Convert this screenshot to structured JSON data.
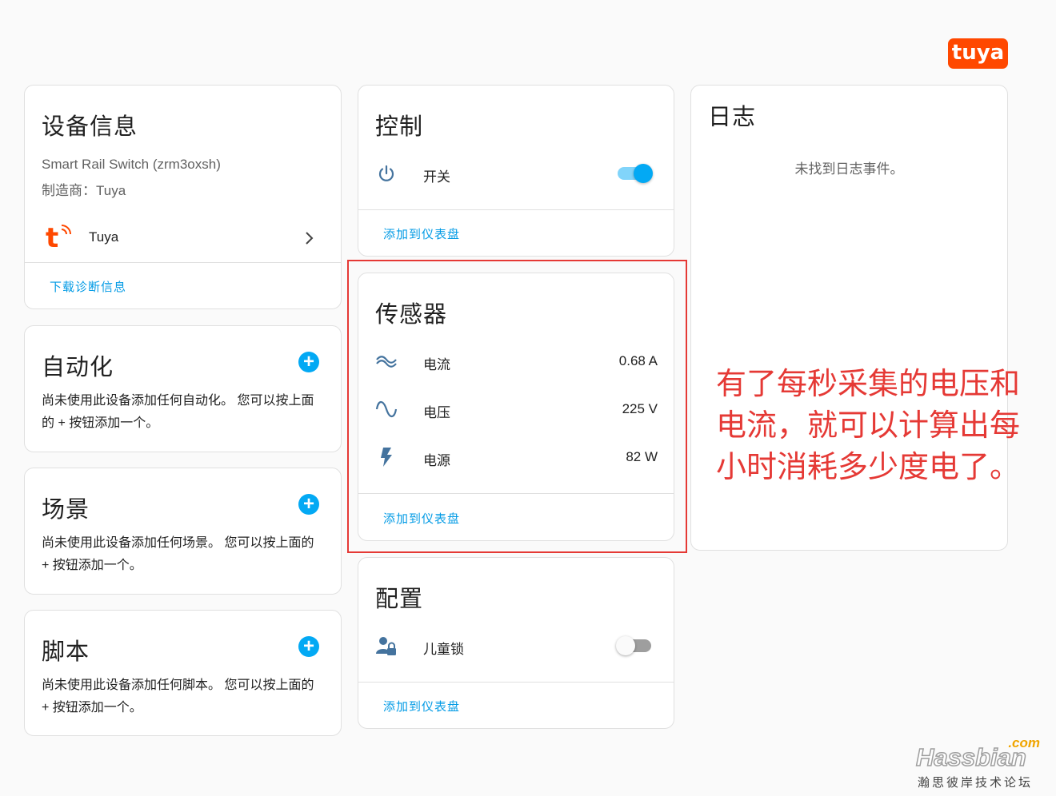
{
  "brand": {
    "logo_text": "tuya",
    "color": "#ff4800"
  },
  "device_info": {
    "title": "设备信息",
    "model": "Smart Rail Switch (zrm3oxsh)",
    "manufacturer": "制造商：Tuya",
    "integration": "Tuya",
    "download_diagnostics": "下载诊断信息"
  },
  "automation": {
    "title": "自动化",
    "description": "尚未使用此设备添加任何自动化。 您可以按上面的 + 按钮添加一个。"
  },
  "scene": {
    "title": "场景",
    "description": "尚未使用此设备添加任何场景。 您可以按上面的 + 按钮添加一个。"
  },
  "script": {
    "title": "脚本",
    "description": "尚未使用此设备添加任何脚本。 您可以按上面的 + 按钮添加一个。"
  },
  "control": {
    "title": "控制",
    "switch_label": "开关",
    "switch_on": true,
    "add_to_dashboard": "添加到仪表盘"
  },
  "sensors": {
    "title": "传感器",
    "items": [
      {
        "icon": "current-ac-icon",
        "label": "电流",
        "value": "0.68 A"
      },
      {
        "icon": "sine-wave-icon",
        "label": "电压",
        "value": "225 V"
      },
      {
        "icon": "lightning-bolt-icon",
        "label": "电源",
        "value": "82 W"
      }
    ],
    "add_to_dashboard": "添加到仪表盘"
  },
  "config": {
    "title": "配置",
    "child_lock_label": "儿童锁",
    "child_lock_on": false,
    "add_to_dashboard": "添加到仪表盘"
  },
  "logbook": {
    "title": "日志",
    "empty": "未找到日志事件。"
  },
  "annotation": {
    "text": "有了每秒采集的电压和电流，就可以计算出每小时消耗多少度电了。",
    "color": "#e53935"
  },
  "watermark": {
    "com": ".com",
    "name": "Hassbian",
    "subtitle": "瀚思彼岸技术论坛"
  },
  "colors": {
    "accent": "#03a9f4",
    "link": "#039be5",
    "icon": "#44739e"
  }
}
